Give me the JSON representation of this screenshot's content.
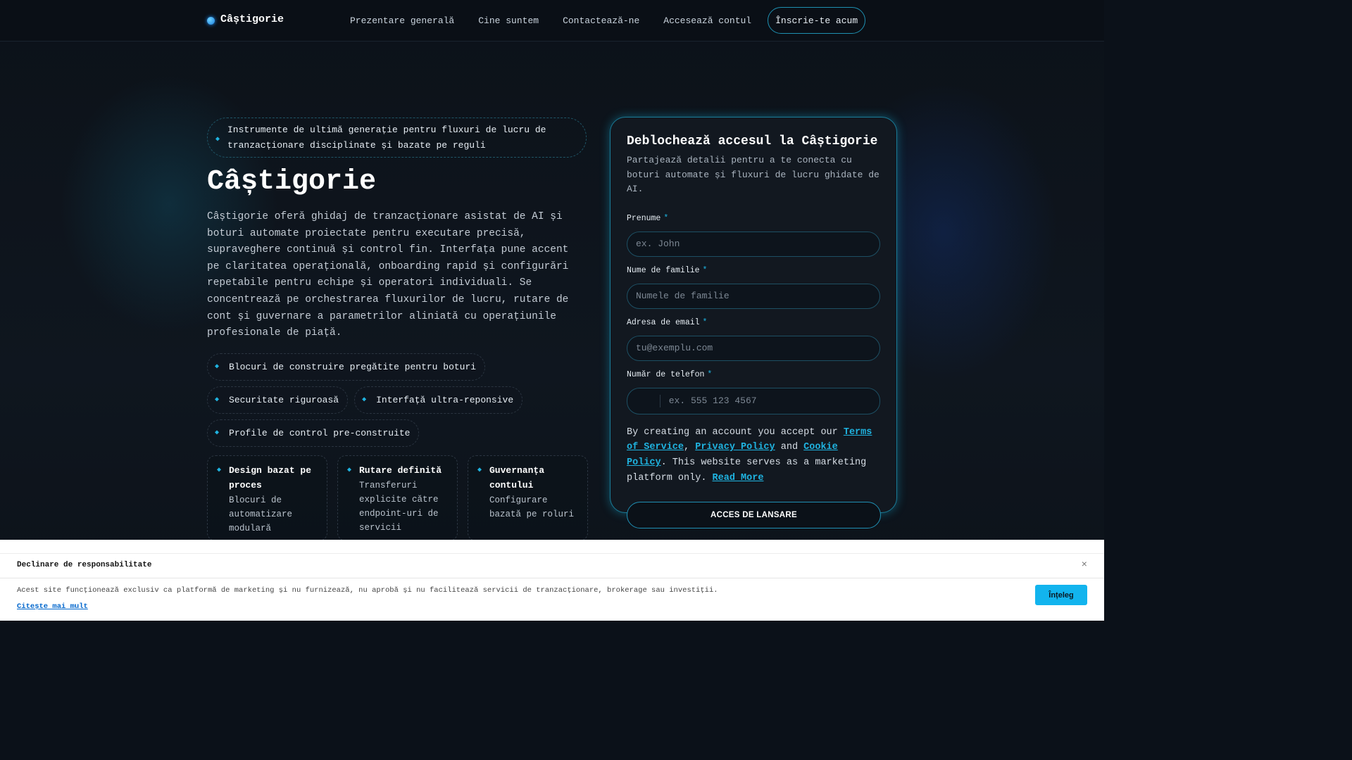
{
  "header": {
    "brand": "Câștigorie",
    "nav": [
      "Prezentare generală",
      "Cine suntem",
      "Contactează-ne",
      "Accesează contul"
    ],
    "cta": "Înscrie-te acum"
  },
  "hero": {
    "tagline": "Instrumente de ultimă generație pentru fluxuri de lucru de tranzacționare disciplinate și bazate pe reguli",
    "title": "Câștigorie",
    "description": "Câștigorie oferă ghidaj de tranzacționare asistat de AI și boturi automate proiectate pentru executare precisă, supraveghere continuă și control fin. Interfața pune accent pe claritatea operațională, onboarding rapid și configurări repetabile pentru echipe și operatori individuali. Se concentrează pe orchestrarea fluxurilor de lucru, rutare de cont și guvernare a parametrilor aliniată cu operațiunile profesionale de piață.",
    "chips": [
      "Blocuri de construire pregătite pentru boturi",
      "Securitate riguroasă",
      "Interfață ultra-reponsive",
      "Profile de control pre-construite"
    ],
    "cards": [
      {
        "title": "Design bazat pe proces",
        "text": "Blocuri de automatizare modulară"
      },
      {
        "title": "Rutare definită",
        "text": "Transferuri explicite către endpoint-uri de servicii"
      },
      {
        "title": "Guvernanța contului",
        "text": "Configurare bazată pe roluri"
      }
    ]
  },
  "form": {
    "title": "Deblochează accesul la Câștigorie",
    "subtitle": "Partajează detalii pentru a te conecta cu boturi automate și fluxuri de lucru ghidate de AI.",
    "fields": [
      {
        "label": "Prenume",
        "placeholder": "ex. John"
      },
      {
        "label": "Nume de familie",
        "placeholder": "Numele de familie"
      },
      {
        "label": "Adresa de email",
        "placeholder": "tu@exemplu.com"
      },
      {
        "label": "Număr de telefon",
        "placeholder": "ex. 555 123 4567"
      }
    ],
    "required_mark": "*",
    "legal": {
      "prefix": "By creating an account you accept our ",
      "terms": "Terms of Service",
      "sep1": ", ",
      "privacy": "Privacy Policy",
      "sep2": " and ",
      "cookie": "Cookie Policy",
      "suffix": ". This website serves as a marketing platform only. ",
      "read_more": "Read More"
    },
    "submit": "ACCES DE LANSARE"
  },
  "disclaimer": {
    "title": "Declinare de responsabilitate",
    "body": "Acest site funcționează exclusiv ca platformă de marketing și nu furnizează, nu aprobă și nu facilitează servicii de tranzacționare, brokerage sau investiții.",
    "link": "Citește mai mult",
    "button": "Înțeleg",
    "close": "×"
  },
  "colors": {
    "accent": "#1fb3e0",
    "background": "#0b1119",
    "disclaimer_button": "#12b4ee"
  }
}
